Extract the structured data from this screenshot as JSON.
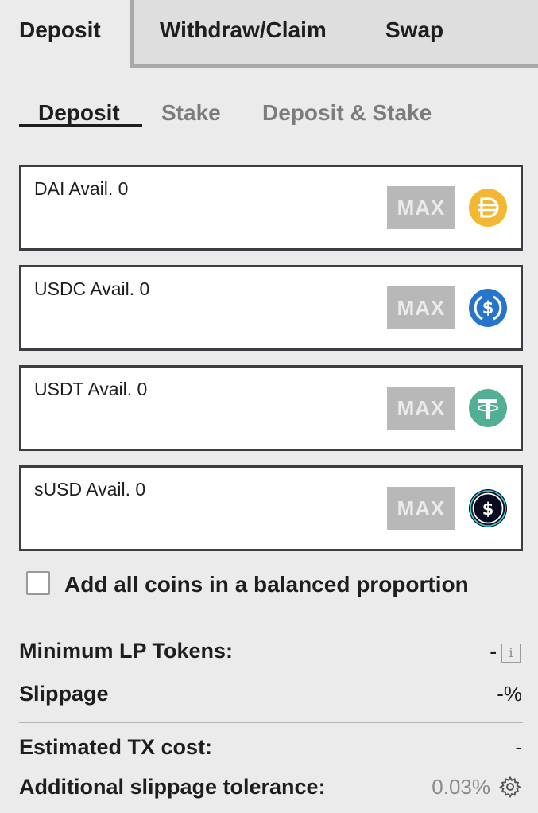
{
  "tabs": {
    "deposit": "Deposit",
    "withdraw": "Withdraw/Claim",
    "swap": "Swap"
  },
  "subtabs": {
    "deposit": "Deposit",
    "stake": "Stake",
    "deposit_stake": "Deposit & Stake"
  },
  "coins": [
    {
      "label": "DAI Avail. 0",
      "max": "MAX",
      "icon": "dai-icon",
      "color": "#f4b731"
    },
    {
      "label": "USDC Avail. 0",
      "max": "MAX",
      "icon": "usdc-icon",
      "color": "#2775ca"
    },
    {
      "label": "USDT Avail. 0",
      "max": "MAX",
      "icon": "usdt-icon",
      "color": "#50af95"
    },
    {
      "label": "sUSD Avail. 0",
      "max": "MAX",
      "icon": "susd-icon",
      "color": "#0b0b22"
    }
  ],
  "balanced": {
    "label": "Add all coins in a balanced proportion",
    "checked": false
  },
  "info": {
    "min_lp_label": "Minimum LP Tokens:",
    "min_lp_value": "-",
    "info_icon_glyph": "i",
    "slippage_label": "Slippage",
    "slippage_value": "-%",
    "tx_cost_label": "Estimated TX cost:",
    "tx_cost_value": "-",
    "slippage_tol_label": "Additional slippage tolerance:",
    "slippage_tol_value": "0.03%"
  }
}
